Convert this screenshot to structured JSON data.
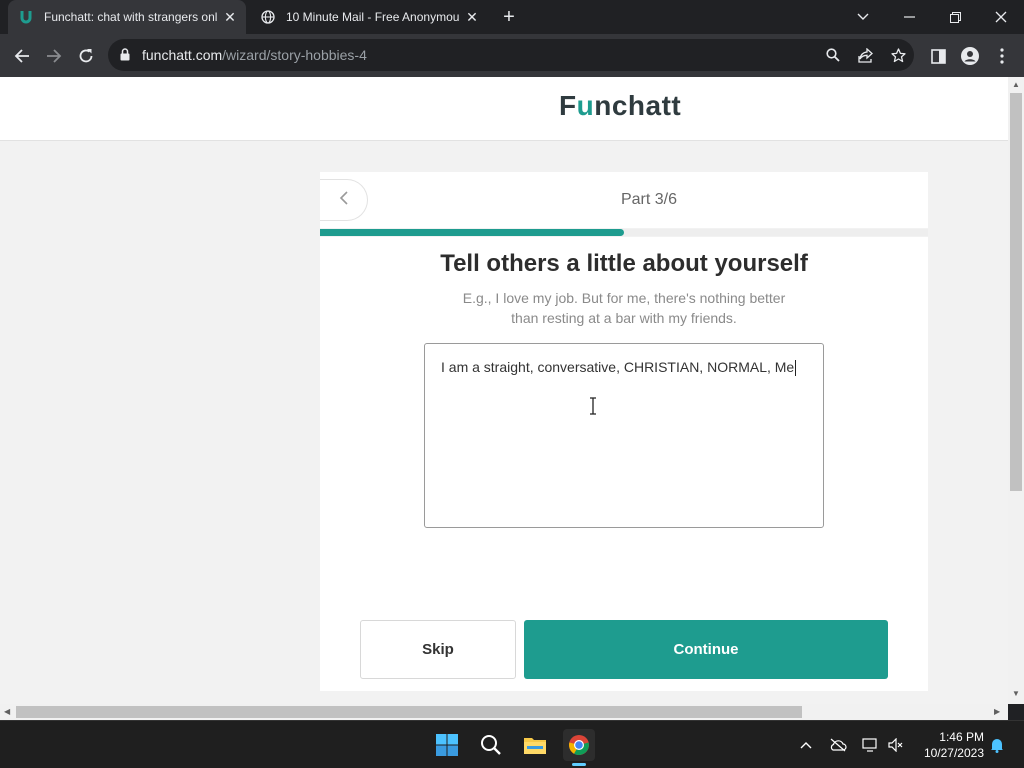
{
  "browser": {
    "tabs": [
      {
        "title": "Funchatt: chat with strangers onl",
        "active": true,
        "favicon": "funchatt-u-icon"
      },
      {
        "title": "10 Minute Mail - Free Anonymou",
        "active": false,
        "favicon": "globe-icon"
      }
    ],
    "url_domain": "funchatt.com",
    "url_path": "/wizard/story-hobbies-4"
  },
  "site": {
    "logo_prefix": "F",
    "logo_u": "u",
    "logo_suffix": "nchatt"
  },
  "wizard": {
    "part_label": "Part 3/6",
    "progress_fraction": 0.5,
    "heading": "Tell others a little about yourself",
    "hint": "E.g., I love my job. But for me, there's nothing better than resting at a bar with my friends.",
    "textarea_value": "I am a straight, conversative, CHRISTIAN, NORMAL, Me",
    "skip_label": "Skip",
    "continue_label": "Continue"
  },
  "taskbar": {
    "time": "1:46 PM",
    "date": "10/27/2023"
  },
  "colors": {
    "accent": "#1e9c8f",
    "page_bg": "#f2f2f2",
    "chrome_dark": "#202124"
  }
}
